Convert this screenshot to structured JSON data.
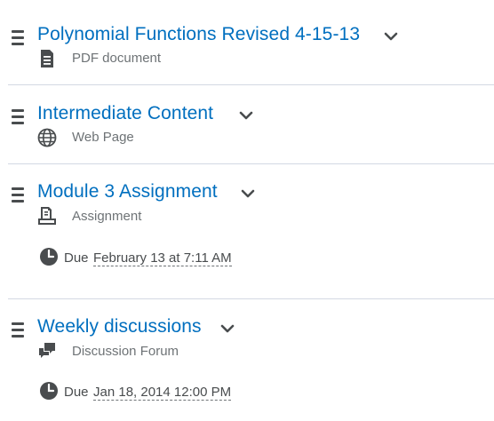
{
  "items": [
    {
      "title": "Polynomial Functions Revised 4-15-13",
      "type_label": "PDF document",
      "type_icon": "document-icon"
    },
    {
      "title": "Intermediate Content",
      "type_label": "Web Page",
      "type_icon": "globe-icon"
    },
    {
      "title": "Module 3 Assignment",
      "type_label": "Assignment",
      "type_icon": "assignment-icon",
      "due_word": "Due",
      "due_date": "February 13 at 7:11 AM"
    },
    {
      "title": "Weekly discussions",
      "type_label": "Discussion Forum",
      "type_icon": "discussion-icon",
      "due_word": "Due",
      "due_date": "Jan 18, 2014 12:00 PM"
    }
  ],
  "colors": {
    "link": "#006fbf",
    "text": "#494c4e",
    "muted": "#6e7376",
    "divider": "#d3d9e3"
  }
}
